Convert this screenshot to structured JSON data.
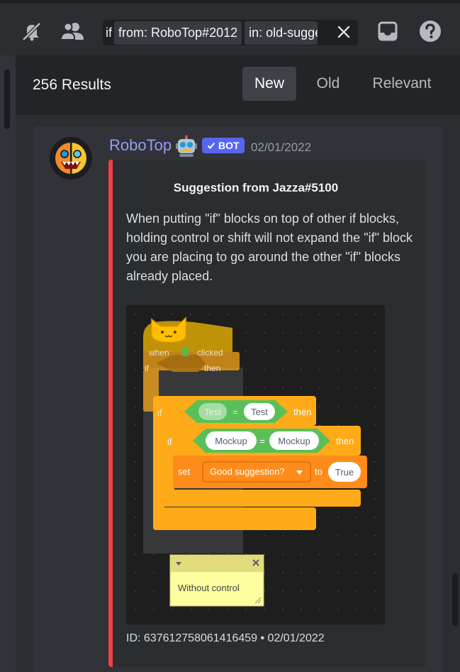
{
  "toolbar": {
    "search_keyword": "if",
    "filters": [
      "from: RoboTop#2012",
      "in: old-suggestions"
    ]
  },
  "results": {
    "count_label": "256 Results",
    "sort_tabs": [
      {
        "label": "New",
        "active": true
      },
      {
        "label": "Old",
        "active": false
      },
      {
        "label": "Relevant",
        "active": false
      }
    ]
  },
  "message": {
    "author": "RoboTop",
    "badge": "BOT",
    "timestamp": "02/01/2022",
    "embed": {
      "accent_color": "#f23f43",
      "title": "Suggestion from Jazza#5100",
      "description": "When putting \"if\" blocks on top of other if blocks, holding control or shift will not expand the \"if\" block you are placing to go around the other \"if\" blocks already placed.",
      "footer": "ID: 637612758061416459 • 02/01/2022",
      "image": {
        "when_label": "when",
        "clicked_label": "clicked",
        "if_label": "if",
        "then_label": "then",
        "test_left": "Test",
        "equals": "=",
        "test_right": "Test",
        "mockup_left": "Mockup",
        "mockup_right": "Mockup",
        "set_label": "set",
        "variable": "Good suggestion?",
        "to_label": "to",
        "value": "True",
        "note": "Without control"
      }
    }
  },
  "colors": {
    "accent": "#5865f2",
    "author": "#949cf7",
    "block_control": "#ffab19",
    "block_operator": "#59c059",
    "block_variable": "#ff8c1a"
  }
}
